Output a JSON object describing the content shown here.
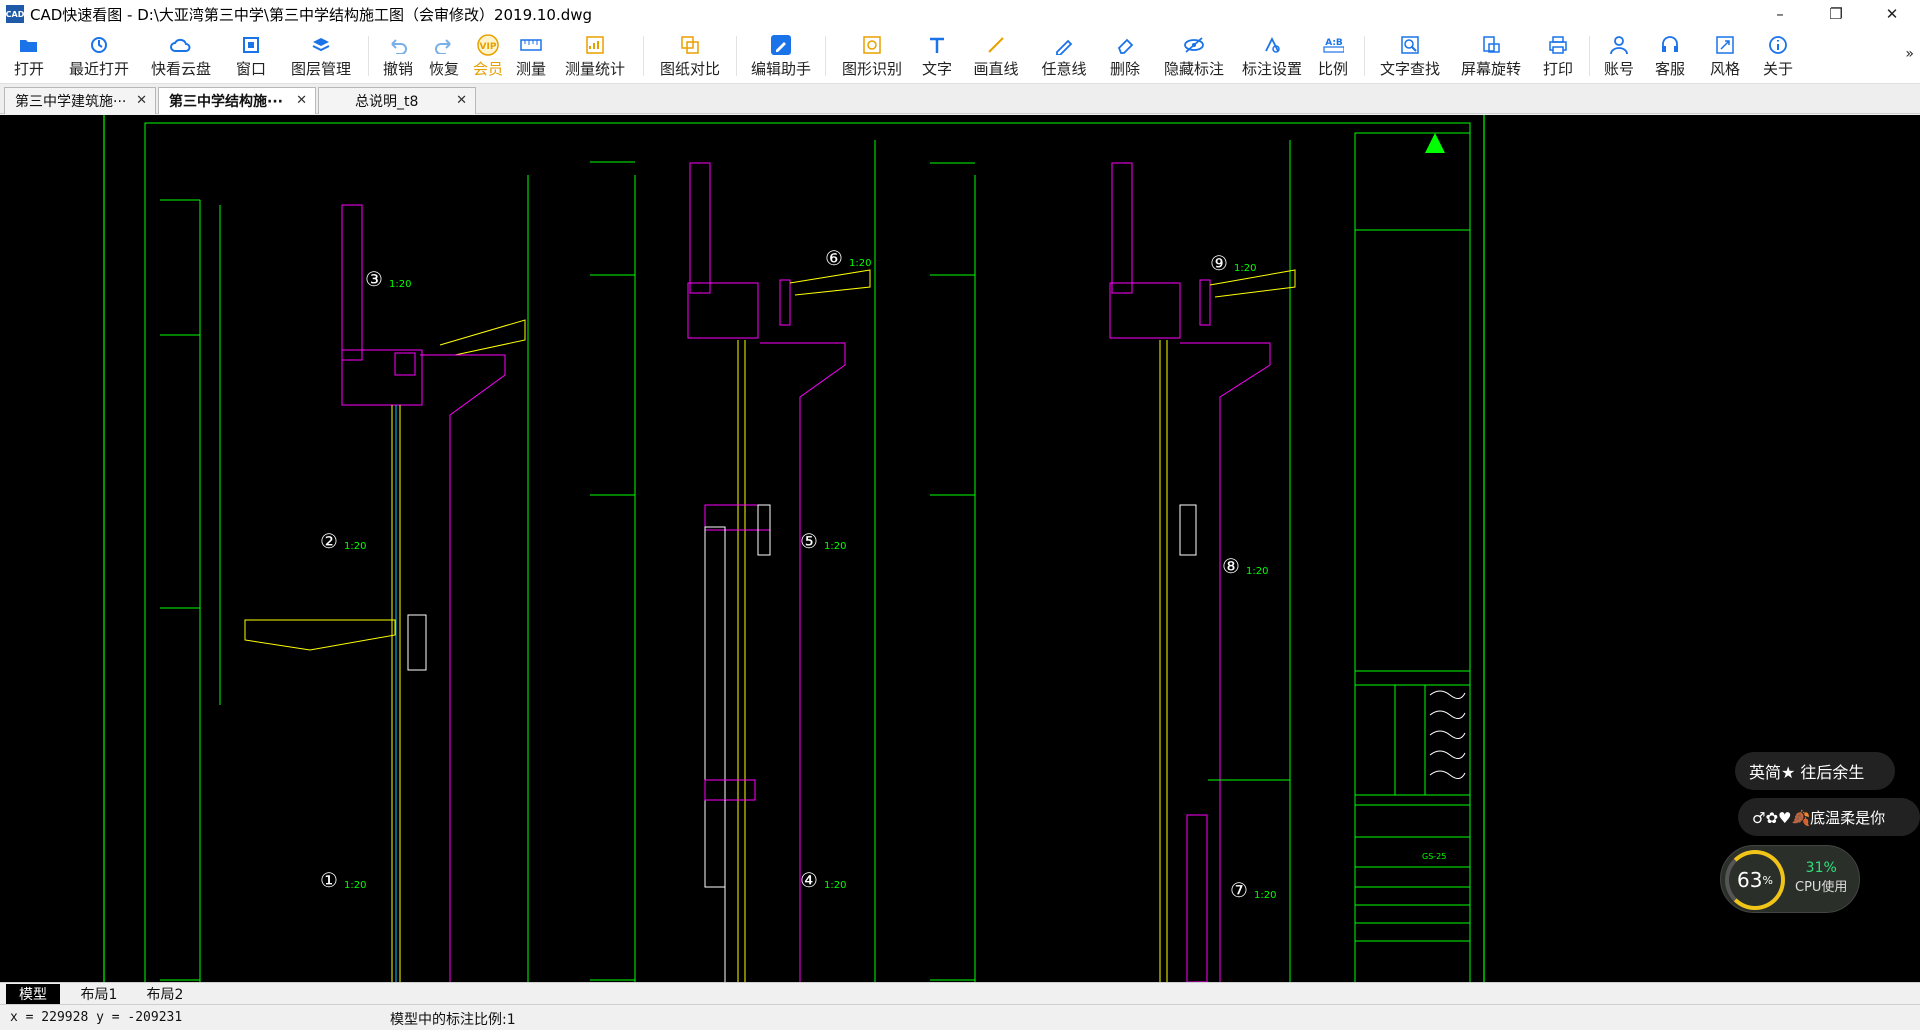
{
  "window": {
    "title": "CAD快速看图 - D:\\大亚湾第三中学\\第三中学结构施工图（会审修改）2019.10.dwg",
    "icon_text": "CAD",
    "controls": [
      "–",
      "❐",
      "✕"
    ]
  },
  "toolbar": {
    "items": [
      {
        "label": "打开",
        "icon": "folder-open-icon"
      },
      {
        "label": "最近打开",
        "icon": "recent-icon"
      },
      {
        "label": "快看云盘",
        "icon": "cloud-icon"
      },
      {
        "label": "窗口",
        "icon": "window-icon"
      },
      {
        "label": "图层管理",
        "icon": "layers-icon"
      },
      {
        "label": "撤销",
        "icon": "undo-icon"
      },
      {
        "label": "恢复",
        "icon": "redo-icon"
      },
      {
        "label": "会员",
        "icon": "vip-icon"
      },
      {
        "label": "测量",
        "icon": "ruler-icon"
      },
      {
        "label": "测量统计",
        "icon": "measure-stats-icon"
      },
      {
        "label": "图纸对比",
        "icon": "compare-icon"
      },
      {
        "label": "编辑助手",
        "icon": "edit-assistant-icon"
      },
      {
        "label": "图形识别",
        "icon": "shape-recognize-icon"
      },
      {
        "label": "文字",
        "icon": "text-icon"
      },
      {
        "label": "画直线",
        "icon": "line-icon"
      },
      {
        "label": "任意线",
        "icon": "freehand-icon"
      },
      {
        "label": "删除",
        "icon": "eraser-icon"
      },
      {
        "label": "隐藏标注",
        "icon": "hide-annotation-icon"
      },
      {
        "label": "标注设置",
        "icon": "annotation-settings-icon"
      },
      {
        "label": "比例",
        "icon": "scale-icon"
      },
      {
        "label": "文字查找",
        "icon": "text-search-icon"
      },
      {
        "label": "屏幕旋转",
        "icon": "rotate-screen-icon"
      },
      {
        "label": "打印",
        "icon": "printer-icon"
      },
      {
        "label": "账号",
        "icon": "account-icon"
      },
      {
        "label": "客服",
        "icon": "headset-icon"
      },
      {
        "label": "风格",
        "icon": "style-icon"
      },
      {
        "label": "关于",
        "icon": "info-icon"
      }
    ],
    "more": "»",
    "vip_badge": "VIP",
    "scale_badge": "A:B"
  },
  "tabs": [
    {
      "label": "第三中学建筑施···",
      "active": false
    },
    {
      "label": "第三中学结构施···",
      "active": true
    },
    {
      "label": "总说明_t8",
      "active": false
    }
  ],
  "drawing": {
    "detail_labels": [
      {
        "num": "③",
        "scale": "1:20"
      },
      {
        "num": "⑥",
        "scale": "1:20"
      },
      {
        "num": "⑨",
        "scale": "1:20"
      },
      {
        "num": "②",
        "scale": "1:20"
      },
      {
        "num": "⑤",
        "scale": "1:20"
      },
      {
        "num": "⑧",
        "scale": "1:20"
      },
      {
        "num": "①",
        "scale": "1:20"
      },
      {
        "num": "④",
        "scale": "1:20"
      },
      {
        "num": "⑦",
        "scale": "1:20"
      }
    ],
    "title_block_codes": [
      "GS-25"
    ]
  },
  "layout_tabs": [
    "模型",
    "布局1",
    "布局2"
  ],
  "status": {
    "coords": "x = 229928  y = -209231",
    "scale_note": "模型中的标注比例:1"
  },
  "overlay": {
    "pill1": "英简★ 往后余生",
    "pill2": "♂✿♥🍂底温柔是你",
    "cpu_percent": "63",
    "cpu_pct_sign": "%",
    "cpu_usage": "31%",
    "cpu_label": "CPU使用"
  },
  "colors": {
    "cad_green": "#00ff00",
    "cad_magenta": "#ff00ff",
    "cad_yellow": "#ffff00",
    "cad_white": "#ffffff",
    "toolbar_icon_blue": "#1a73e8",
    "vip_gold": "#e8a000"
  }
}
